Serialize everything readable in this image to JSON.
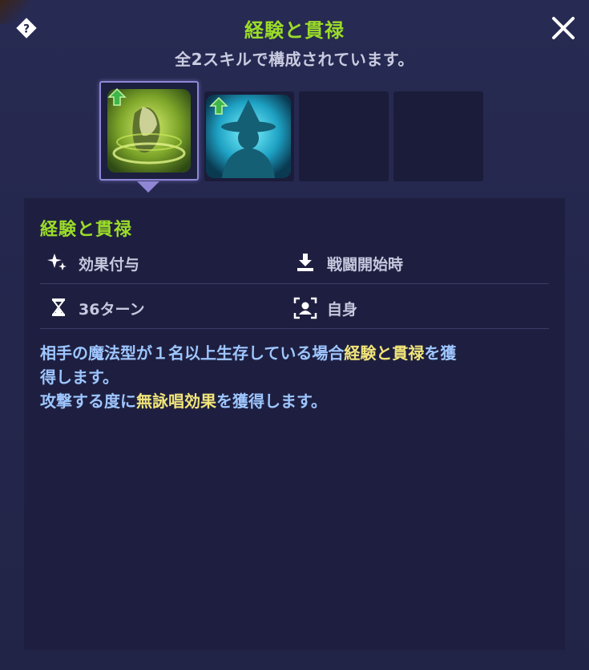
{
  "header": {
    "title": "経験と貫禄",
    "subtitle": "全2スキルで構成されています。"
  },
  "icons": {
    "help": "help-diamond-icon",
    "close": "close-icon"
  },
  "skill_slots": [
    {
      "name": "経験と貫禄",
      "selected": true,
      "upgrade": true,
      "icon": "green-aura-figure-icon"
    },
    {
      "name": "",
      "selected": false,
      "upgrade": true,
      "icon": "witch-silhouette-icon"
    },
    {
      "name": "",
      "selected": false,
      "upgrade": false,
      "icon": "empty"
    },
    {
      "name": "",
      "selected": false,
      "upgrade": false,
      "icon": "empty"
    }
  ],
  "detail": {
    "skill_name": "経験と貫禄",
    "effect_type": "効果付与",
    "timing": "戦闘開始時",
    "duration": "36ターン",
    "target": "自身",
    "description": {
      "line1_a": "相手の魔法型が１名以上生存している場合",
      "line1_hl": "経験と貫禄",
      "line1_b": "を獲",
      "line2": "得します。",
      "line3_a": "攻撃する度に",
      "line3_hl": "無詠唱効果",
      "line3_b": "を獲得します。"
    }
  },
  "colors": {
    "title_green": "#9bdc28",
    "description_blue": "#9ec6ff",
    "highlight_yellow": "#f1e57a",
    "panel_bg": "#24264c"
  }
}
